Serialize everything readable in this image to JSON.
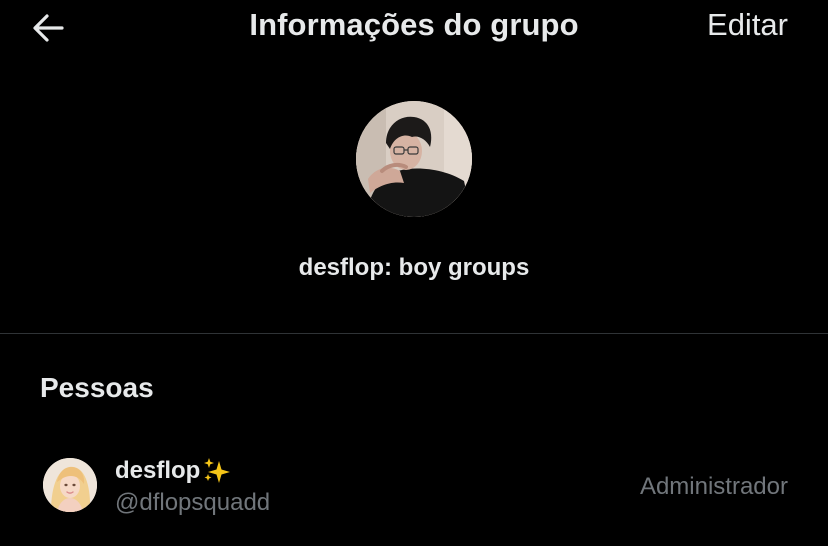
{
  "header": {
    "title": "Informações do grupo",
    "edit_label": "Editar",
    "back_icon": "arrow-left-icon"
  },
  "group": {
    "name": "desflop: boy groups",
    "avatar": "group-photo"
  },
  "people": {
    "section_title": "Pessoas",
    "members": [
      {
        "name": "desflop",
        "emoji": "sparkles-icon",
        "handle": "@dflopsquadd",
        "role": "Administrador"
      }
    ]
  },
  "colors": {
    "background": "#000000",
    "primary_text": "#e7e9ea",
    "secondary_text": "#71767b",
    "divider": "#2f3336",
    "sparkle": "#f5c518"
  }
}
